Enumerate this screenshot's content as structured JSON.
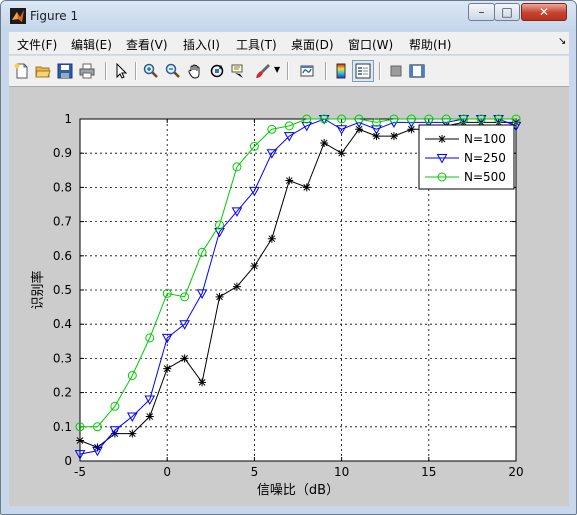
{
  "window": {
    "title": "Figure 1",
    "minimize_label": "–",
    "maximize_label": "□",
    "close_label": "✕"
  },
  "menu": {
    "items": [
      "文件(F)",
      "编辑(E)",
      "查看(V)",
      "插入(I)",
      "工具(T)",
      "桌面(D)",
      "窗口(W)",
      "帮助(H)"
    ],
    "overflow_arrow": "↘"
  },
  "toolbar": {
    "icons": [
      "new-figure-icon",
      "open-folder-icon",
      "save-icon",
      "print-icon",
      "edit-plot-arrow-icon",
      "zoom-in-icon",
      "zoom-out-icon",
      "pan-hand-icon",
      "rotate-3d-icon",
      "data-cursor-icon",
      "brush-icon",
      "brush-dropdown-icon",
      "link-plot-icon",
      "colorbar-icon",
      "legend-icon",
      "hide-plot-tools-icon",
      "show-plot-tools-icon"
    ]
  },
  "colors": {
    "N100": "#000000",
    "N250": "#0000ff",
    "N500": "#00cc00",
    "axes_bg": "#ffffff",
    "figure_bg": "#cccccc"
  },
  "chart_data": {
    "type": "line",
    "title": "",
    "xlabel": "信噪比（dB）",
    "ylabel": "识别率",
    "xlim": [
      -5,
      20
    ],
    "ylim": [
      0,
      1
    ],
    "xticks": [
      "-5",
      "0",
      "5",
      "10",
      "15",
      "20"
    ],
    "yticks": [
      "0",
      "0.1",
      "0.2",
      "0.3",
      "0.4",
      "0.5",
      "0.6",
      "0.7",
      "0.8",
      "0.9",
      "1"
    ],
    "grid": true,
    "legend_position": "top-right",
    "x": [
      -5,
      -4,
      -3,
      -2,
      -1,
      0,
      1,
      2,
      3,
      4,
      5,
      6,
      7,
      8,
      9,
      10,
      11,
      12,
      13,
      14,
      15,
      16,
      17,
      18,
      19,
      20
    ],
    "series": [
      {
        "name": "N=100",
        "marker": "asterisk",
        "color": "#000000",
        "values": [
          0.06,
          0.04,
          0.08,
          0.08,
          0.13,
          0.27,
          0.3,
          0.23,
          0.48,
          0.51,
          0.57,
          0.65,
          0.82,
          0.8,
          0.93,
          0.9,
          0.97,
          0.95,
          0.95,
          0.97,
          0.97,
          0.98,
          0.99,
          0.99,
          0.99,
          0.99
        ]
      },
      {
        "name": "N=250",
        "marker": "triangle-down",
        "color": "#0000ff",
        "values": [
          0.02,
          0.03,
          0.09,
          0.13,
          0.18,
          0.36,
          0.4,
          0.49,
          0.67,
          0.73,
          0.79,
          0.9,
          0.95,
          0.98,
          1.0,
          0.97,
          0.99,
          0.97,
          0.99,
          0.99,
          0.99,
          0.99,
          1.0,
          1.0,
          1.0,
          0.98
        ]
      },
      {
        "name": "N=500",
        "marker": "circle",
        "color": "#00cc00",
        "values": [
          0.1,
          0.1,
          0.16,
          0.25,
          0.36,
          0.49,
          0.48,
          0.61,
          0.69,
          0.86,
          0.92,
          0.97,
          0.98,
          1.0,
          1.0,
          1.0,
          1.0,
          0.99,
          1.0,
          1.0,
          1.0,
          1.0,
          1.0,
          1.0,
          1.0,
          1.0
        ]
      }
    ]
  }
}
